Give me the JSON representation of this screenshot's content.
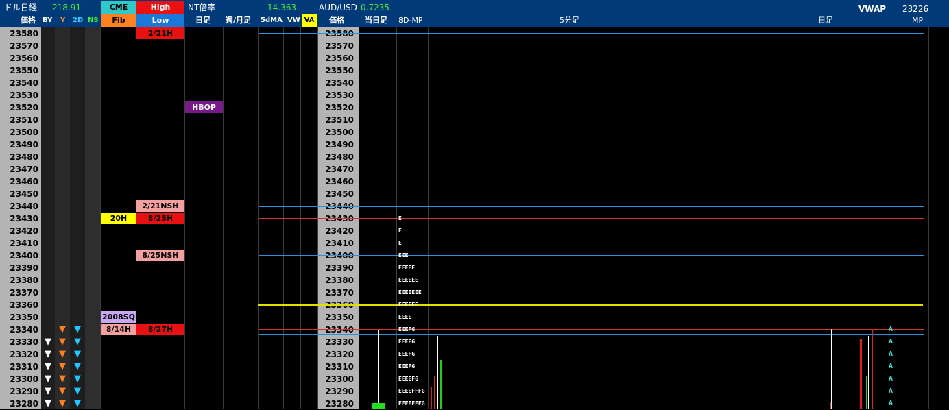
{
  "header": {
    "dollar_nikkei_label": "ドル日経",
    "dollar_nikkei_value": "218.91",
    "cme_label": "CME",
    "high_label": "High",
    "nt_label": "NT倍率",
    "nt_value": "14.363",
    "aud_label": "AUD/USD",
    "aud_value": "0.7235",
    "vwap_label": "VWAP",
    "vwap_value": "23226",
    "columns": {
      "price_left": "価格",
      "by": "BY",
      "y": "Y",
      "d2": "2D",
      "ns": "NS",
      "fib": "Fib",
      "low": "Low",
      "daily": "日足",
      "weekly_monthly": "週/月足",
      "ma5d": "5dMA",
      "vw": "VW",
      "va": "VA",
      "price_right": "価格",
      "today": "当日足",
      "mp8d": "8D-MP",
      "five_min": "5分足",
      "daily_right": "日足",
      "mp": "MP"
    }
  },
  "prices": [
    "23580",
    "23570",
    "23560",
    "23550",
    "23540",
    "23530",
    "23520",
    "23510",
    "23500",
    "23490",
    "23480",
    "23470",
    "23460",
    "23450",
    "23440",
    "23430",
    "23420",
    "23410",
    "23400",
    "23390",
    "23380",
    "23370",
    "23360",
    "23350",
    "23340",
    "23330",
    "23320",
    "23310",
    "23300",
    "23290",
    "23280"
  ],
  "tags": [
    {
      "text": "2/21H",
      "row": 0,
      "col": "high",
      "bg": "#e81010",
      "fg": "#000"
    },
    {
      "text": "HBOP",
      "row": 6,
      "col": "daily",
      "bg": "#7a1a8a",
      "fg": "#fff"
    },
    {
      "text": "2/21NSH",
      "row": 14,
      "col": "high",
      "bg": "#f4a0a0",
      "fg": "#000"
    },
    {
      "text": "20H",
      "row": 15,
      "col": "fib",
      "bg": "#ffff00",
      "fg": "#000"
    },
    {
      "text": "8/25H",
      "row": 15,
      "col": "high",
      "bg": "#e81010",
      "fg": "#000"
    },
    {
      "text": "8/25NSH",
      "row": 18,
      "col": "high",
      "bg": "#f4a0a0",
      "fg": "#000"
    },
    {
      "text": "2008SQ",
      "row": 23,
      "col": "fib",
      "bg": "#c8a8f0",
      "fg": "#000"
    },
    {
      "text": "8/14H",
      "row": 24,
      "col": "fib",
      "bg": "#f4a0a0",
      "fg": "#000"
    },
    {
      "text": "8/27H",
      "row": 24,
      "col": "high",
      "bg": "#e81010",
      "fg": "#000"
    }
  ],
  "market_profile": [
    {
      "row": 15,
      "letters": "E"
    },
    {
      "row": 16,
      "letters": "E"
    },
    {
      "row": 17,
      "letters": "E"
    },
    {
      "row": 18,
      "letters": "EEE"
    },
    {
      "row": 19,
      "letters": "EEEEE"
    },
    {
      "row": 20,
      "letters": "EEEEEE"
    },
    {
      "row": 21,
      "letters": "EEEEEEE"
    },
    {
      "row": 22,
      "letters": "EEEEEE"
    },
    {
      "row": 23,
      "letters": "EEEE"
    },
    {
      "row": 24,
      "letters": "EEEFG"
    },
    {
      "row": 25,
      "letters": "EEEFG"
    },
    {
      "row": 26,
      "letters": "EEEFG"
    },
    {
      "row": 27,
      "letters": "EEEFG"
    },
    {
      "row": 28,
      "letters": "EEEEFG"
    },
    {
      "row": 29,
      "letters": "EEEEFFFG"
    },
    {
      "row": 30,
      "letters": "EEEEFFFG"
    }
  ],
  "mp_markers": {
    "symbol": "A",
    "rows": [
      24,
      25,
      26,
      27,
      28,
      29,
      30
    ],
    "color": "#40e0e0"
  },
  "triangles": {
    "by_rows": [
      25,
      26,
      27,
      28,
      29,
      30
    ],
    "y_rows": [
      24,
      25,
      26,
      27,
      28,
      29,
      30
    ],
    "d2_rows": [
      24,
      25,
      26,
      27,
      28,
      29,
      30
    ]
  },
  "levels": [
    {
      "row": 0,
      "color": "#2d8fd8",
      "label": "blue"
    },
    {
      "row": 14,
      "color": "#2d8fd8",
      "label": "blue"
    },
    {
      "row": 15,
      "color": "#d83030",
      "label": "red"
    },
    {
      "row": 18,
      "color": "#2d8fd8",
      "label": "blue"
    },
    {
      "row": 22,
      "color": "#e0e000",
      "label": "yellow"
    },
    {
      "row": 24,
      "color": "#d83030",
      "label": "red"
    },
    {
      "row": 24.4,
      "color": "#2d8fd8",
      "label": "blue"
    }
  ]
}
